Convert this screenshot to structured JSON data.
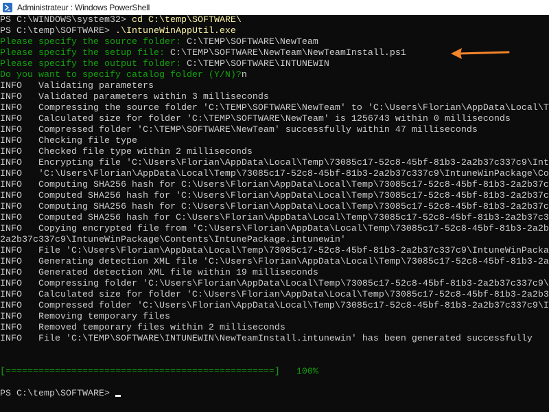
{
  "window": {
    "title": "Administrateur : Windows PowerShell",
    "icon": "powershell-icon"
  },
  "colors": {
    "background": "#0c0c0c",
    "text": "#cccccc",
    "command": "#f9f1a5",
    "prompt_green": "#13a10e",
    "arrow": "#f5852a"
  },
  "lines": [
    [
      {
        "c": "w",
        "t": "PS C:\\WINDOWS\\system32> "
      },
      {
        "c": "y",
        "t": "cd C:\\temp\\SOFTWARE\\"
      }
    ],
    [
      {
        "c": "w",
        "t": "PS C:\\temp\\SOFTWARE> "
      },
      {
        "c": "y",
        "t": ".\\IntuneWinAppUtil.exe"
      }
    ],
    [
      {
        "c": "g",
        "t": "Please specify the source folder: "
      },
      {
        "c": "w",
        "t": "C:\\TEMP\\SOFTWARE\\NewTeam"
      }
    ],
    [
      {
        "c": "g",
        "t": "Please specify the setup file: "
      },
      {
        "c": "w",
        "t": "C:\\TEMP\\SOFTWARE\\NewTeam\\NewTeamInstall.ps1"
      }
    ],
    [
      {
        "c": "g",
        "t": "Please specify the output folder: "
      },
      {
        "c": "w",
        "t": "C:\\TEMP\\SOFTWARE\\INTUNEWIN"
      }
    ],
    [
      {
        "c": "g",
        "t": "Do you want to specify catalog folder (Y/N)?"
      },
      {
        "c": "w",
        "t": "n"
      }
    ],
    [
      {
        "c": "w",
        "t": "INFO   Validating parameters"
      }
    ],
    [
      {
        "c": "w",
        "t": "INFO   Validated parameters within 3 milliseconds"
      }
    ],
    [
      {
        "c": "w",
        "t": "INFO   Compressing the source folder 'C:\\TEMP\\SOFTWARE\\NewTeam' to 'C:\\Users\\Florian\\AppData\\Local\\T"
      }
    ],
    [
      {
        "c": "w",
        "t": "INFO   Calculated size for folder 'C:\\TEMP\\SOFTWARE\\NewTeam' is 1256743 within 0 milliseconds"
      }
    ],
    [
      {
        "c": "w",
        "t": "INFO   Compressed folder 'C:\\TEMP\\SOFTWARE\\NewTeam' successfully within 47 milliseconds"
      }
    ],
    [
      {
        "c": "w",
        "t": "INFO   Checking file type"
      }
    ],
    [
      {
        "c": "w",
        "t": "INFO   Checked file type within 2 milliseconds"
      }
    ],
    [
      {
        "c": "w",
        "t": "INFO   Encrypting file 'C:\\Users\\Florian\\AppData\\Local\\Temp\\73085c17-52c8-45bf-81b3-2a2b37c337c9\\Int"
      }
    ],
    [
      {
        "c": "w",
        "t": "INFO   'C:\\Users\\Florian\\AppData\\Local\\Temp\\73085c17-52c8-45bf-81b3-2a2b37c337c9\\IntuneWinPackage\\Co"
      }
    ],
    [
      {
        "c": "w",
        "t": "INFO   Computing SHA256 hash for C:\\Users\\Florian\\AppData\\Local\\Temp\\73085c17-52c8-45bf-81b3-2a2b37c"
      }
    ],
    [
      {
        "c": "w",
        "t": "INFO   Computed SHA256 hash for 'C:\\Users\\Florian\\AppData\\Local\\Temp\\73085c17-52c8-45bf-81b3-2a2b37c"
      }
    ],
    [
      {
        "c": "w",
        "t": "INFO   Computing SHA256 hash for C:\\Users\\Florian\\AppData\\Local\\Temp\\73085c17-52c8-45bf-81b3-2a2b37c"
      }
    ],
    [
      {
        "c": "w",
        "t": "INFO   Computed SHA256 hash for C:\\Users\\Florian\\AppData\\Local\\Temp\\73085c17-52c8-45bf-81b3-2a2b37c3"
      }
    ],
    [
      {
        "c": "w",
        "t": "INFO   Copying encrypted file from 'C:\\Users\\Florian\\AppData\\Local\\Temp\\73085c17-52c8-45bf-81b3-2a2b"
      }
    ],
    [
      {
        "c": "w",
        "t": "2a2b37c337c9\\IntuneWinPackage\\Contents\\IntunePackage.intunewin'"
      }
    ],
    [
      {
        "c": "w",
        "t": "INFO   File 'C:\\Users\\Florian\\AppData\\Local\\Temp\\73085c17-52c8-45bf-81b3-2a2b37c337c9\\IntuneWinPacka"
      }
    ],
    [
      {
        "c": "w",
        "t": "INFO   Generating detection XML file 'C:\\Users\\Florian\\AppData\\Local\\Temp\\73085c17-52c8-45bf-81b3-2a"
      }
    ],
    [
      {
        "c": "w",
        "t": "INFO   Generated detection XML file within 19 milliseconds"
      }
    ],
    [
      {
        "c": "w",
        "t": "INFO   Compressing folder 'C:\\Users\\Florian\\AppData\\Local\\Temp\\73085c17-52c8-45bf-81b3-2a2b37c337c9\\"
      }
    ],
    [
      {
        "c": "w",
        "t": "INFO   Calculated size for folder 'C:\\Users\\Florian\\AppData\\Local\\Temp\\73085c17-52c8-45bf-81b3-2a2b3"
      }
    ],
    [
      {
        "c": "w",
        "t": "INFO   Compressed folder 'C:\\Users\\Florian\\AppData\\Local\\Temp\\73085c17-52c8-45bf-81b3-2a2b37c337c9\\I"
      }
    ],
    [
      {
        "c": "w",
        "t": "INFO   Removing temporary files"
      }
    ],
    [
      {
        "c": "w",
        "t": "INFO   Removed temporary files within 2 milliseconds"
      }
    ],
    [
      {
        "c": "w",
        "t": "INFO   File 'C:\\TEMP\\SOFTWARE\\INTUNEWIN\\NewTeamInstall.intunewin' has been generated successfully"
      }
    ],
    [],
    [],
    [
      {
        "c": "g",
        "t": "[=================================================]   100%"
      }
    ],
    [],
    [
      {
        "c": "w",
        "t": "PS C:\\temp\\SOFTWARE> "
      }
    ]
  ],
  "progress": {
    "percent": 100,
    "label": "100%"
  },
  "annotation": {
    "icon": "arrow-left-icon",
    "points_to_line": "Please specify the setup file"
  }
}
